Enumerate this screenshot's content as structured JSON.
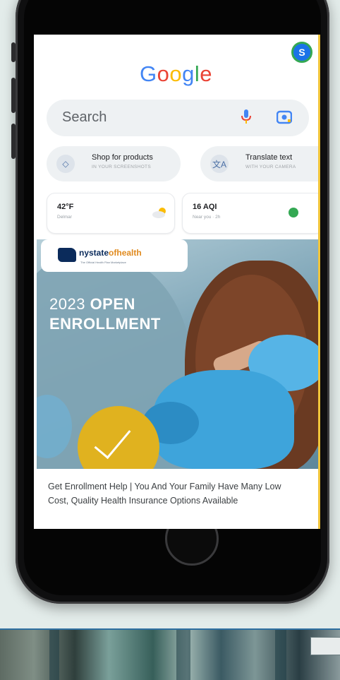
{
  "google": {
    "logo": "Google",
    "avatar_letter": "S",
    "search_placeholder": "Search"
  },
  "chips": [
    {
      "title": "Shop for products",
      "subtitle": "IN YOUR SCREENSHOTS"
    },
    {
      "title": "Translate text",
      "subtitle": "WITH YOUR CAMERA"
    }
  ],
  "weather": {
    "temp": "42°F",
    "location": "Delmar"
  },
  "air_quality": {
    "value": "16 AQI",
    "subtitle": "Near you · 2h",
    "status_color": "#34a853"
  },
  "ad": {
    "brand_prefix": "nystate",
    "brand_suffix": "ofhealth",
    "brand_tag": "The Official Health Plan Marketplace",
    "headline_light": "2023 ",
    "headline_bold_1": "OPEN",
    "headline_bold_2": "ENROLLMENT",
    "body": "Get Enrollment Help | You And Your Family Have Many Low Cost, Quality Health Insurance Options Available"
  },
  "colors": {
    "google_blue": "#4285F4",
    "google_red": "#EA4335",
    "google_yellow": "#FBBC05",
    "google_green": "#34A853",
    "accent_gold": "#e0b21f"
  }
}
